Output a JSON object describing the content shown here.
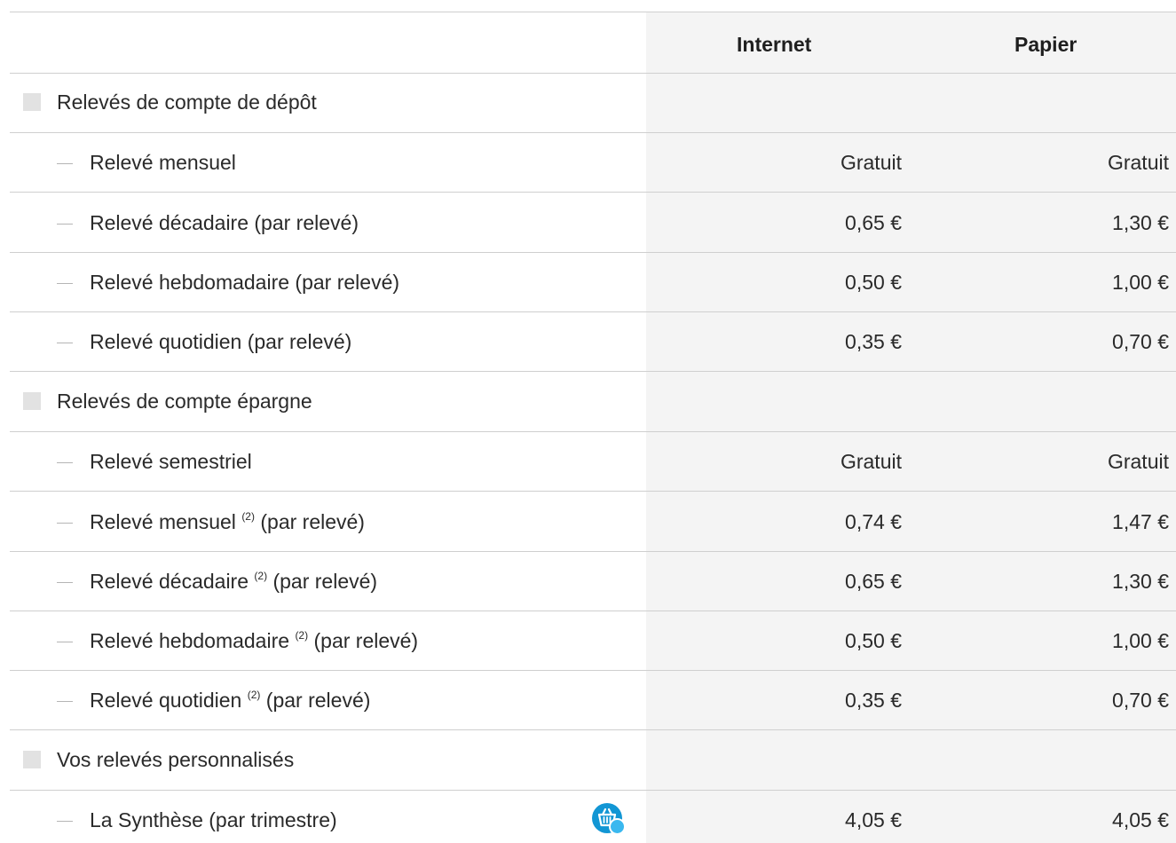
{
  "header": {
    "internet": "Internet",
    "papier": "Papier"
  },
  "sections": {
    "depot": {
      "title": "Relevés de compte de dépôt"
    },
    "epargne": {
      "title": "Relevés de compte épargne"
    },
    "perso": {
      "title": "Vos relevés personnalisés"
    }
  },
  "rows": {
    "depot_mensuel": {
      "label": "Relevé mensuel",
      "internet": "Gratuit",
      "papier": "Gratuit"
    },
    "depot_decadaire": {
      "label": "Relevé décadaire (par relevé)",
      "internet": "0,65 €",
      "papier": "1,30 €"
    },
    "depot_hebdo": {
      "label": "Relevé hebdomadaire (par relevé)",
      "internet": "0,50 €",
      "papier": "1,00 €"
    },
    "depot_quotidien": {
      "label": "Relevé quotidien (par relevé)",
      "internet": "0,35 €",
      "papier": "0,70 €"
    },
    "epargne_semestriel": {
      "label": "Relevé semestriel",
      "internet": "Gratuit",
      "papier": "Gratuit"
    },
    "epargne_mensuel": {
      "label": "Relevé mensuel",
      "note": "(2)",
      "suffix": "(par relevé)",
      "internet": "0,74 €",
      "papier": "1,47 €"
    },
    "epargne_decadaire": {
      "label": "Relevé décadaire",
      "note": "(2)",
      "suffix": "(par relevé)",
      "internet": "0,65 €",
      "papier": "1,30 €"
    },
    "epargne_hebdo": {
      "label": "Relevé hebdomadaire",
      "note": "(2)",
      "suffix": "(par relevé)",
      "internet": "0,50 €",
      "papier": "1,00 €"
    },
    "epargne_quotidien": {
      "label": "Relevé quotidien",
      "note": "(2)",
      "suffix": "(par relevé)",
      "internet": "0,35 €",
      "papier": "0,70 €"
    },
    "synthese": {
      "label": "La Synthèse (par trimestre)",
      "internet": "4,05 €",
      "papier": "4,05 €",
      "icon": "shopping-basket-icon"
    }
  },
  "colors": {
    "accent": "#1296d4",
    "shade": "#f4f4f4",
    "rule": "#cfcfcf"
  }
}
